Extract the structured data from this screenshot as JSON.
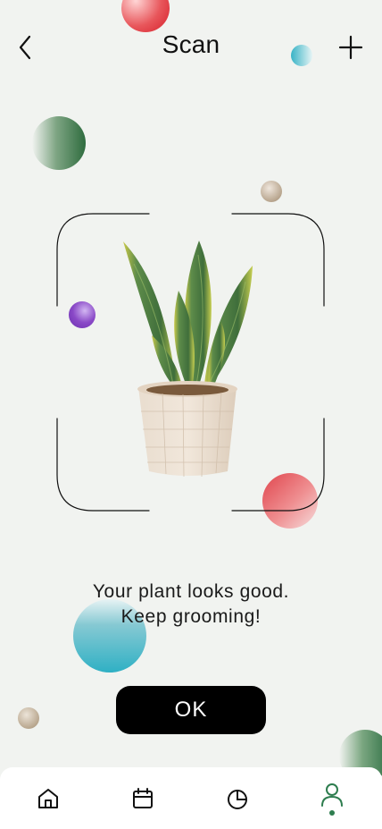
{
  "header": {
    "title": "Scan",
    "back_icon": "chevron-left-icon",
    "add_icon": "plus-icon"
  },
  "message": {
    "line1": "Your plant looks good.",
    "line2": "Keep grooming!"
  },
  "ok_button": {
    "label": "OK"
  },
  "nav": {
    "items": [
      {
        "name": "home",
        "icon": "home-icon",
        "active": false
      },
      {
        "name": "calendar",
        "icon": "calendar-icon",
        "active": false
      },
      {
        "name": "stats",
        "icon": "pie-chart-icon",
        "active": false
      },
      {
        "name": "profile",
        "icon": "user-icon",
        "active": true
      }
    ]
  },
  "colors": {
    "background": "#f1f3f0",
    "accent_green": "#2e7d4f",
    "button": "#000000"
  }
}
